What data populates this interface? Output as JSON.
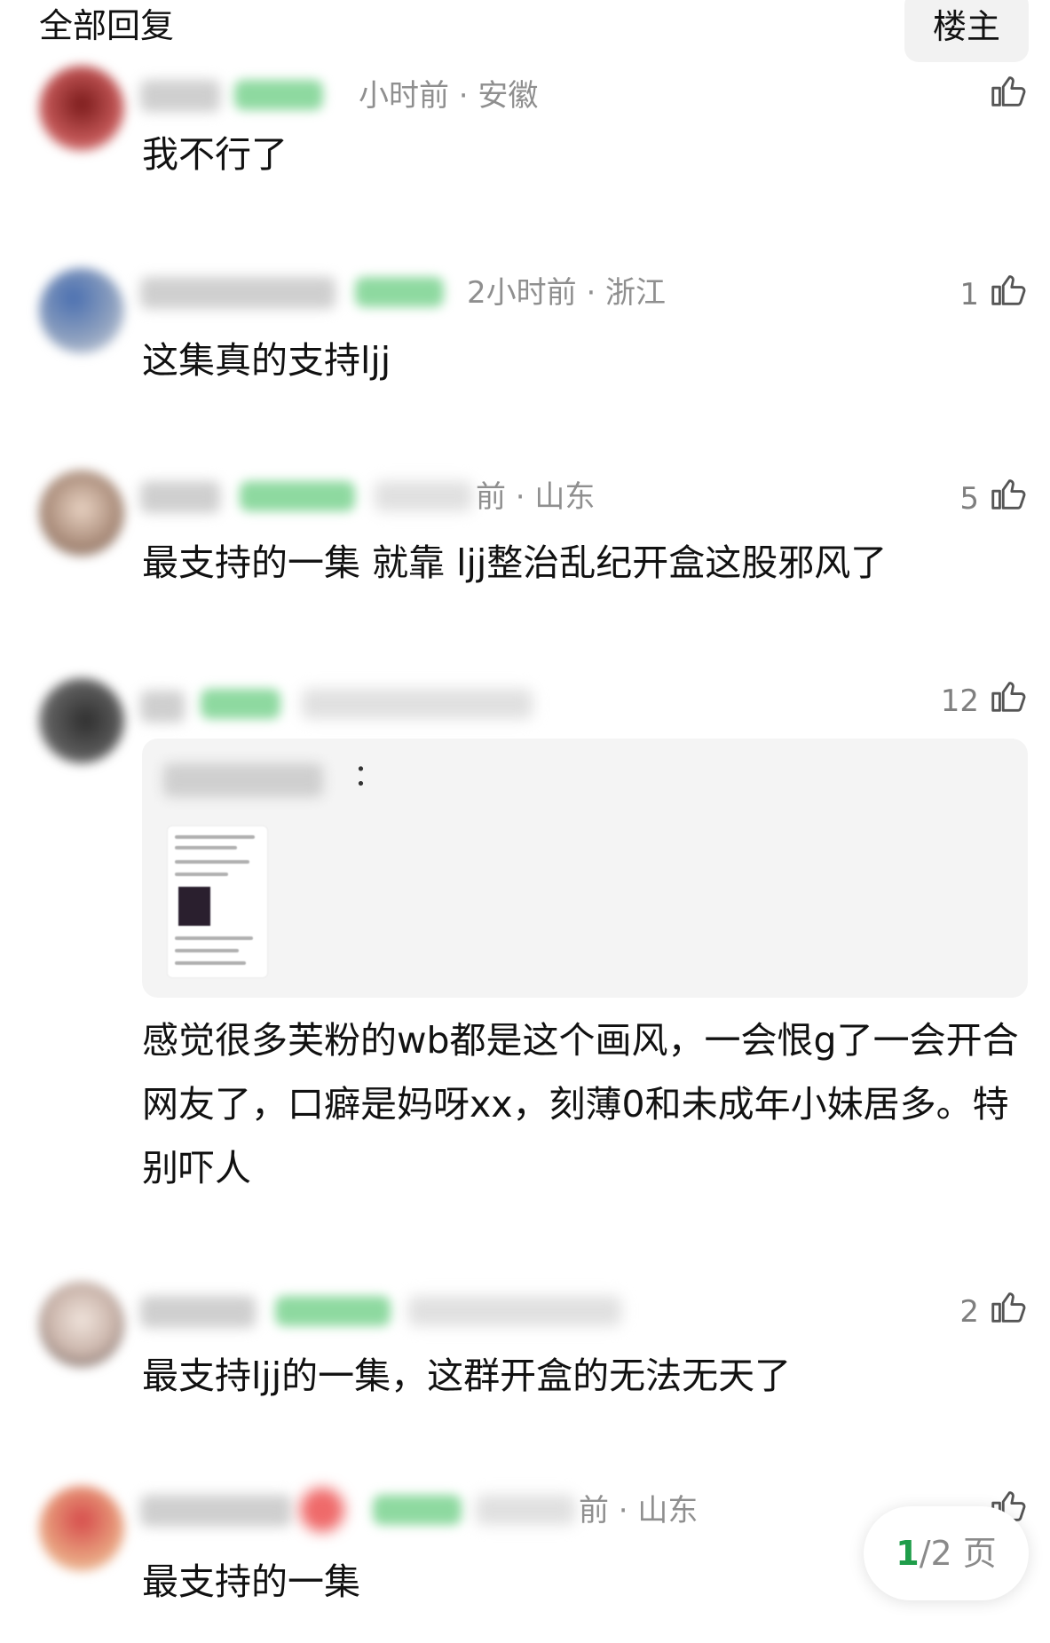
{
  "header": {
    "title": "全部回复",
    "op_button": "楼主"
  },
  "comments": [
    {
      "meta": "小时前 · 安徽",
      "likes": "",
      "text": "我不行了"
    },
    {
      "meta": "2小时前 · 浙江",
      "likes": "1",
      "text": "这集真的支持ljj"
    },
    {
      "meta": "前 · 山东",
      "likes": "5",
      "text": "最支持的一集 就靠 ljj整治乱纪开盒这股邪风了"
    },
    {
      "meta": "",
      "likes": "12",
      "quote_colon": "：",
      "text": "感觉很多芙粉的wb都是这个画风，一会恨g了一会开合网友了，口癖是妈呀xx，刻薄0和未成年小妹居多。特别吓人"
    },
    {
      "meta": "",
      "likes": "2",
      "text": "最支持ljj的一集，这群开盒的无法无天了"
    },
    {
      "meta": "前 · 山东",
      "likes": "",
      "text": "最支持的一集"
    }
  ],
  "pager": {
    "current": "1",
    "rest": "/2 页"
  },
  "colors": {
    "accent_green": "#1f9d4a",
    "meta_gray": "#8f8f8f",
    "quote_bg": "#f4f4f4"
  },
  "icons": {
    "like": "thumbs-up-icon"
  }
}
